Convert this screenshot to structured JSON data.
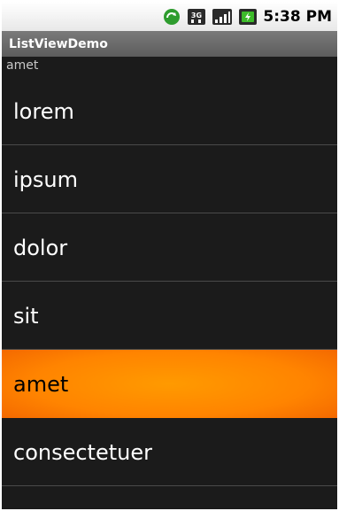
{
  "status": {
    "time": "5:38 PM"
  },
  "app": {
    "title": "ListViewDemo"
  },
  "selection": {
    "text": "amet"
  },
  "list": {
    "items": [
      {
        "label": "lorem"
      },
      {
        "label": "ipsum"
      },
      {
        "label": "dolor"
      },
      {
        "label": "sit"
      },
      {
        "label": "amet",
        "selected": true
      },
      {
        "label": "consectetuer"
      }
    ]
  },
  "colors": {
    "selected_highlight": "#ff8400",
    "list_background": "#1b1b1b",
    "titlebar": "#6a6a6a"
  }
}
